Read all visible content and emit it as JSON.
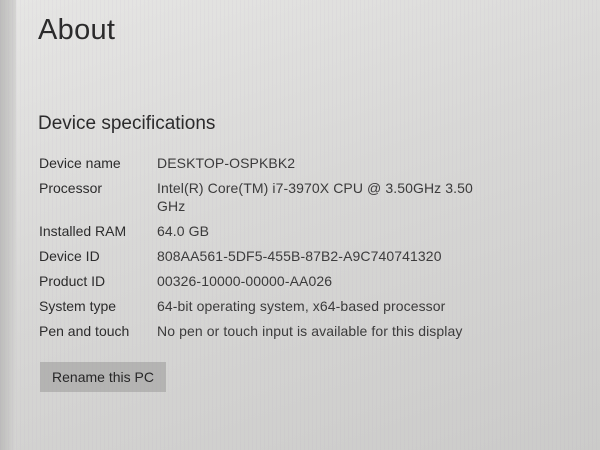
{
  "page": {
    "title": "About"
  },
  "device_specifications": {
    "heading": "Device specifications",
    "rows": [
      {
        "label": "Device name",
        "value": "DESKTOP-OSPKBK2"
      },
      {
        "label": "Processor",
        "value": "Intel(R) Core(TM) i7-3970X CPU @ 3.50GHz   3.50 GHz"
      },
      {
        "label": "Installed RAM",
        "value": "64.0 GB"
      },
      {
        "label": "Device ID",
        "value": "808AA561-5DF5-455B-87B2-A9C740741320"
      },
      {
        "label": "Product ID",
        "value": "00326-10000-00000-AA026"
      },
      {
        "label": "System type",
        "value": "64-bit operating system, x64-based processor"
      },
      {
        "label": "Pen and touch",
        "value": "No pen or touch input is available for this display"
      }
    ],
    "rename_button_label": "Rename this PC"
  }
}
